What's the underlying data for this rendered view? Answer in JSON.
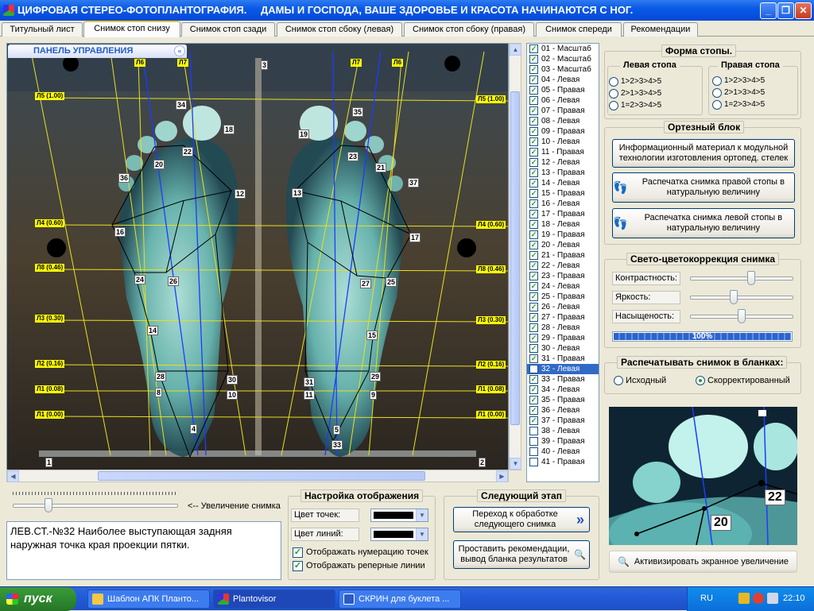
{
  "window": {
    "title": "ЦИФРОВАЯ СТЕРЕО-ФОТОПЛАНТОГРАФИЯ.",
    "slogan": "ДАМЫ И ГОСПОДА, ВАШЕ ЗДОРОВЬЕ И КРАСОТА НАЧИНАЮТСЯ С НОГ."
  },
  "tabs": [
    "Титульный лист",
    "Снимок стоп снизу",
    "Снимок стоп сзади",
    "Снимок стоп сбоку (левая)",
    "Снимок стоп сбоку (правая)",
    "Снимок спереди",
    "Рекомендации"
  ],
  "active_tab": 1,
  "control_panel": {
    "title": "ПАНЕЛЬ УПРАВЛЕНИЯ",
    "toggle": "«"
  },
  "reference_lines": [
    {
      "left_label": "Л5 (1.00)",
      "right_label": "Л5 (1.00)"
    },
    {
      "left_label": "Л4 (0.60)",
      "right_label": "Л4 (0.60)"
    },
    {
      "left_label": "Л8 (0.46)",
      "right_label": "Л8 (0.46)"
    },
    {
      "left_label": "Л3 (0.30)",
      "right_label": "Л3 (0.30)"
    },
    {
      "left_label": "Л2 (0.16)",
      "right_label": "Л2 (0.16)"
    },
    {
      "left_label": "Л1 (0.08)",
      "right_label": "Л1 (0.08)"
    },
    {
      "left_label": "Л1 (0.00)",
      "right_label": "Л1 (0.00)"
    }
  ],
  "top_labels": [
    "Л6",
    "Л7",
    "Л7",
    "Л6"
  ],
  "points": [
    "1",
    "2",
    "3",
    "4",
    "5",
    "8",
    "9",
    "10",
    "11",
    "12",
    "13",
    "14",
    "15",
    "16",
    "17",
    "18",
    "19",
    "20",
    "21",
    "22",
    "23",
    "24",
    "25",
    "26",
    "27",
    "28",
    "29",
    "30",
    "31",
    "33",
    "34",
    "35",
    "36",
    "37"
  ],
  "point_list": [
    {
      "label": "01 - Масштаб",
      "checked": true
    },
    {
      "label": "02 - Масштаб",
      "checked": true
    },
    {
      "label": "03 - Масштаб",
      "checked": true
    },
    {
      "label": "04 - Левая",
      "checked": true
    },
    {
      "label": "05 - Правая",
      "checked": true
    },
    {
      "label": "06 - Левая",
      "checked": true
    },
    {
      "label": "07 - Правая",
      "checked": true
    },
    {
      "label": "08 - Левая",
      "checked": true
    },
    {
      "label": "09 - Правая",
      "checked": true
    },
    {
      "label": "10 - Левая",
      "checked": true
    },
    {
      "label": "11 - Правая",
      "checked": true
    },
    {
      "label": "12 - Левая",
      "checked": true
    },
    {
      "label": "13 - Правая",
      "checked": true
    },
    {
      "label": "14 - Левая",
      "checked": true
    },
    {
      "label": "15 - Правая",
      "checked": true
    },
    {
      "label": "16 - Левая",
      "checked": true
    },
    {
      "label": "17 - Правая",
      "checked": true
    },
    {
      "label": "18 - Левая",
      "checked": true
    },
    {
      "label": "19 - Правая",
      "checked": true
    },
    {
      "label": "20 - Левая",
      "checked": true
    },
    {
      "label": "21 - Правая",
      "checked": true
    },
    {
      "label": "22 - Левая",
      "checked": true
    },
    {
      "label": "23 - Правая",
      "checked": true
    },
    {
      "label": "24 - Левая",
      "checked": true
    },
    {
      "label": "25 - Правая",
      "checked": true
    },
    {
      "label": "26 - Левая",
      "checked": true
    },
    {
      "label": "27 - Правая",
      "checked": true
    },
    {
      "label": "28 - Левая",
      "checked": true
    },
    {
      "label": "29 - Правая",
      "checked": true
    },
    {
      "label": "30 - Левая",
      "checked": true
    },
    {
      "label": "31 - Правая",
      "checked": true
    },
    {
      "label": "32 - Левая",
      "checked": false,
      "selected": true
    },
    {
      "label": "33 - Правая",
      "checked": true
    },
    {
      "label": "34 - Левая",
      "checked": true
    },
    {
      "label": "35 - Правая",
      "checked": true
    },
    {
      "label": "36 - Левая",
      "checked": true
    },
    {
      "label": "37 - Правая",
      "checked": true
    },
    {
      "label": "38 - Левая",
      "checked": false
    },
    {
      "label": "39 - Правая",
      "checked": false
    },
    {
      "label": "40 - Левая",
      "checked": false
    },
    {
      "label": "41 - Правая",
      "checked": false
    }
  ],
  "foot_shape": {
    "title": "Форма стопы.",
    "left": {
      "title": "Левая стопа",
      "options": [
        "1>2>3>4>5",
        "2>1>3>4>5",
        "1=2>3>4>5"
      ]
    },
    "right": {
      "title": "Правая стопа",
      "options": [
        "1>2>3>4>5",
        "2>1>3>4>5",
        "1=2>3>4>5"
      ]
    }
  },
  "orthotic": {
    "title": "Ортезный блок",
    "info_button": "Информационный материал к модульной технологии изготовления ортопед. стелек",
    "print_right": "Распечатка снимка правой стопы в натуральную величину",
    "print_left": "Распечатка снимка левой стопы в натуральную величину"
  },
  "color_correction": {
    "title": "Свето-цветокоррекция снимка",
    "contrast_label": "Контрастность:",
    "brightness_label": "Яркость:",
    "saturation_label": "Насыщеность:",
    "contrast": 0.6,
    "brightness": 0.42,
    "saturation": 0.5,
    "progress_label": "100%",
    "progress": 1.0
  },
  "print_forms": {
    "title": "Распечатывать снимок в бланках:",
    "original": "Исходный",
    "corrected": "Скорректированный"
  },
  "zoom": {
    "points": [
      "22",
      "20"
    ],
    "activate_button": "Активизировать экранное увеличение",
    "slider_label": "<-- Увеличение снимка",
    "slider_value": 0.2
  },
  "status_text": "ЛЕВ.СТ.-№32 Наиболее выступающая задняя наружная точка края проекции пятки.",
  "display_settings": {
    "title": "Настройка отображения",
    "point_color_label": "Цвет точек:",
    "line_color_label": "Цвет линий:",
    "point_color": "#000000",
    "line_color": "#000000",
    "show_numbers": "Отображать нумерацию точек",
    "show_reference": "Отображать реперные линии"
  },
  "next_stage": {
    "title": "Следующий этап",
    "next_button": "Переход к обработке следующего снимка",
    "recommend_button": "Проставить рекомендации, вывод бланка результатов"
  },
  "taskbar": {
    "start": "пуск",
    "tasks": [
      "Шаблон АПК Планто...",
      "Plantovisor",
      "СКРИН для буклета ..."
    ],
    "lang": "RU",
    "clock": "22:10"
  },
  "colors": {
    "titlebar": "#0a5ae8",
    "label_yellow": "#ffff00",
    "selected": "#316ac5",
    "accent_green": "#21a121"
  }
}
